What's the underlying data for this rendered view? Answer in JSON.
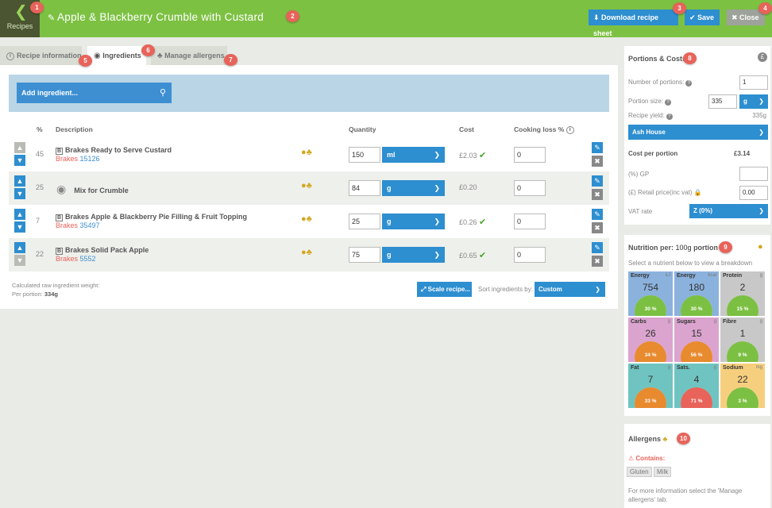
{
  "header": {
    "back_label": "Recipes",
    "title": "Apple & Blackberry Crumble with Custard",
    "download_label": "Download recipe sheet",
    "save_label": "Save",
    "close_label": "Close"
  },
  "tabs": [
    {
      "label": "Recipe information",
      "active": false
    },
    {
      "label": "Ingredients",
      "active": true
    },
    {
      "label": "Manage allergens",
      "active": false
    }
  ],
  "markers": [
    "1",
    "2",
    "3",
    "4",
    "5",
    "6",
    "7",
    "8",
    "9",
    "10"
  ],
  "search": {
    "placeholder": "Add ingredient..."
  },
  "table": {
    "columns": {
      "pct": "%",
      "description": "Description",
      "quantity": "Quantity",
      "cost": "Cost",
      "loss": "Cooking loss %"
    },
    "rows": [
      {
        "pct": "45",
        "name": "Brakes Ready to Serve Custard",
        "supplier": "Brakes",
        "code": "15126",
        "qty": "150",
        "unit": "ml",
        "cost": "£2.03",
        "check": true,
        "loss": "0"
      },
      {
        "pct": "25",
        "name": "Mix for Crumble",
        "supplier": "",
        "code": "",
        "qty": "84",
        "unit": "g",
        "cost": "£0.20",
        "check": false,
        "loss": "0"
      },
      {
        "pct": "7",
        "name": "Brakes Apple & Blackberry Pie Filling & Fruit Topping",
        "supplier": "Brakes",
        "code": "35497",
        "qty": "25",
        "unit": "g",
        "cost": "£0.26",
        "check": true,
        "loss": "0"
      },
      {
        "pct": "22",
        "name": "Brakes Solid Pack Apple",
        "supplier": "Brakes",
        "code": "5552",
        "qty": "75",
        "unit": "g",
        "cost": "£0.65",
        "check": true,
        "loss": "0"
      }
    ]
  },
  "footer": {
    "raw_weight_label": "Calculated raw ingredient weight:",
    "per_portion_label": "Per portion:",
    "per_portion_value": "334g",
    "scale_label": "Scale recipe...",
    "sort_label": "Sort ingredients by:",
    "sort_value": "Custom"
  },
  "portions": {
    "title": "Portions & Costs",
    "num_portions_label": "Number of portions:",
    "num_portions": "1",
    "portion_size_label": "Portion size:",
    "portion_size": "335",
    "portion_unit": "g",
    "yield_label": "Recipe yield:",
    "yield_value": "335g",
    "site": "Ash House",
    "cost_label": "Cost per portion",
    "cost_value": "£3.14",
    "gp_label": "(%) GP",
    "gp_value": "",
    "retail_label": "(£) Retail price(inc vat)",
    "retail_value": "0.00",
    "vat_label": "VAT rate",
    "vat_value": "Z (0%)"
  },
  "nutrition": {
    "per_label": "Nutrition per:",
    "per_100g": "100g",
    "per_portion": "portion",
    "hint": "Select a nutrient below to view a breakdown",
    "tiles": [
      {
        "label": "Energy",
        "unit": "kJ",
        "value": "754",
        "pct": "30 %",
        "bg": "#8bb2dd",
        "fill": "#7cc043"
      },
      {
        "label": "Energy",
        "unit": "kcal",
        "value": "180",
        "pct": "30 %",
        "bg": "#8bb2dd",
        "fill": "#7cc043"
      },
      {
        "label": "Protein",
        "unit": "g",
        "value": "2",
        "pct": "15 %",
        "bg": "#c8c8c8",
        "fill": "#7cc043"
      },
      {
        "label": "Carbs",
        "unit": "g",
        "value": "26",
        "pct": "34 %",
        "bg": "#dba4cf",
        "fill": "#e88a2e"
      },
      {
        "label": "Sugars",
        "unit": "g",
        "value": "15",
        "pct": "56 %",
        "bg": "#dba4cf",
        "fill": "#e88a2e"
      },
      {
        "label": "Fibre",
        "unit": "g",
        "value": "1",
        "pct": "9 %",
        "bg": "#c8c8c8",
        "fill": "#7cc043"
      },
      {
        "label": "Fat",
        "unit": "g",
        "value": "7",
        "pct": "33 %",
        "bg": "#6fc4c1",
        "fill": "#e88a2e"
      },
      {
        "label": "Sats.",
        "unit": "g",
        "value": "4",
        "pct": "71 %",
        "bg": "#6fc4c1",
        "fill": "#e8635a"
      },
      {
        "label": "Sodium",
        "unit": "mg",
        "value": "22",
        "pct": "3 %",
        "bg": "#f6cf7e",
        "fill": "#7cc043"
      }
    ]
  },
  "allergens": {
    "title": "Allergens",
    "contains_label": "Contains:",
    "items": [
      "Gluten",
      "Milk"
    ],
    "note": "For more information select the 'Manage allergens' tab."
  },
  "colors": {
    "header": "#7dc143",
    "accent": "#2d8ed0",
    "marker": "#e8635a"
  }
}
